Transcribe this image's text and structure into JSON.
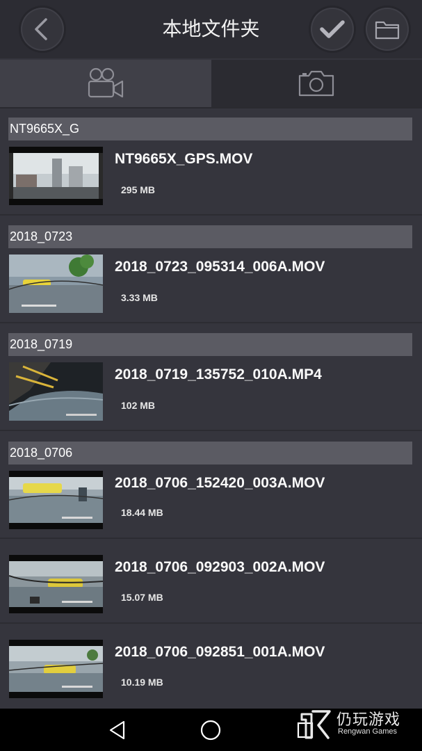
{
  "header": {
    "title": "本地文件夹",
    "back_icon": "chevron-left-icon",
    "confirm_icon": "checkmark-icon",
    "folder_icon": "folder-icon"
  },
  "tabs": [
    {
      "name": "video",
      "icon": "video-camera-icon",
      "active": true
    },
    {
      "name": "photo",
      "icon": "photo-camera-icon",
      "active": false
    }
  ],
  "groups": [
    {
      "header": "NT9665X_G",
      "files": [
        {
          "name": "NT9665X_GPS.MOV",
          "size": "295 MB"
        }
      ]
    },
    {
      "header": "2018_0723",
      "files": [
        {
          "name": "2018_0723_095314_006A.MOV",
          "size": "3.33 MB"
        }
      ]
    },
    {
      "header": "2018_0719",
      "files": [
        {
          "name": "2018_0719_135752_010A.MP4",
          "size": "102 MB"
        }
      ]
    },
    {
      "header": "2018_0706",
      "files": [
        {
          "name": "2018_0706_152420_003A.MOV",
          "size": "18.44 MB"
        },
        {
          "name": "2018_0706_092903_002A.MOV",
          "size": "15.07 MB"
        },
        {
          "name": "2018_0706_092851_001A.MOV",
          "size": "10.19 MB"
        }
      ]
    }
  ],
  "watermark": {
    "title": "仍玩游戏",
    "subtitle": "Rengwan Games"
  },
  "colors": {
    "background": "#35353d",
    "header": "#2c2c33",
    "group_header": "#5b5b63"
  }
}
